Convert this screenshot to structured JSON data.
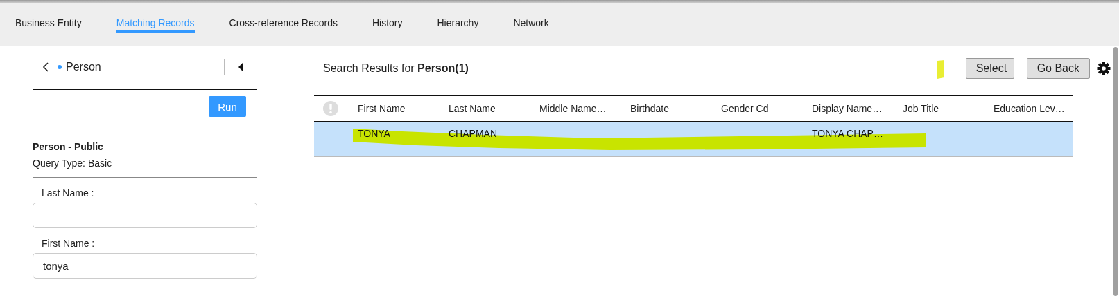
{
  "tabs": [
    {
      "label": "Business Entity",
      "selected": false
    },
    {
      "label": "Matching Records",
      "selected": true
    },
    {
      "label": "Cross-reference Records",
      "selected": false
    },
    {
      "label": "History",
      "selected": false
    },
    {
      "label": "Hierarchy",
      "selected": false
    },
    {
      "label": "Network",
      "selected": false
    }
  ],
  "query_panel": {
    "entity": "Person",
    "run_button": "Run",
    "query_name": "Person - Public",
    "query_type": "Query Type: Basic",
    "fields": [
      {
        "label": "Last Name :"
      },
      {
        "label": "First Name :",
        "value": "tonya"
      }
    ]
  },
  "results": {
    "title": "Search Results for **Person(1)**",
    "buttons": [
      "Select",
      "Go Back"
    ],
    "table": {
      "columns": [
        "First Name",
        "Last Name",
        "Middle Name…",
        "Birthdate",
        "Gender Cd",
        "Display Name…",
        "Job Title",
        "Education Lev…"
      ],
      "rows": [
        {
          "selected": true,
          "cells": [
            "TONYA",
            "CHAPMAN",
            "",
            "",
            "",
            "TONYA CHAP…",
            "",
            ""
          ]
        }
      ]
    }
  }
}
